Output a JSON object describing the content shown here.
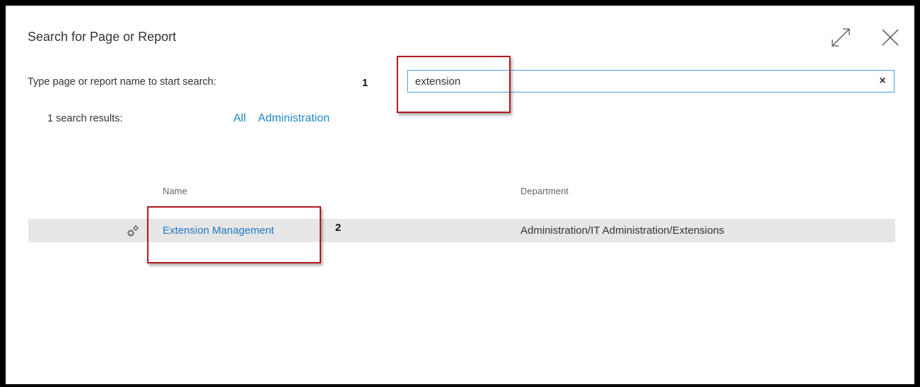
{
  "dialog": {
    "title": "Search for Page or Report",
    "expand_icon": "expand-icon",
    "close_icon": "close-icon"
  },
  "search": {
    "prompt": "Type page or report name to start search:",
    "value": "extension",
    "clear_label": "×"
  },
  "annotations": {
    "step1": "1",
    "step2": "2"
  },
  "results": {
    "count_text": "1 search results:",
    "filters": [
      "All",
      "Administration"
    ],
    "columns": {
      "name": "Name",
      "department": "Department"
    },
    "rows": [
      {
        "icon": "gears-icon",
        "name": "Extension Management",
        "department": "Administration/IT Administration/Extensions"
      }
    ]
  },
  "colors": {
    "accent": "#1e88c7",
    "highlight": "#b0191e",
    "row_background": "#e6e6e6"
  }
}
